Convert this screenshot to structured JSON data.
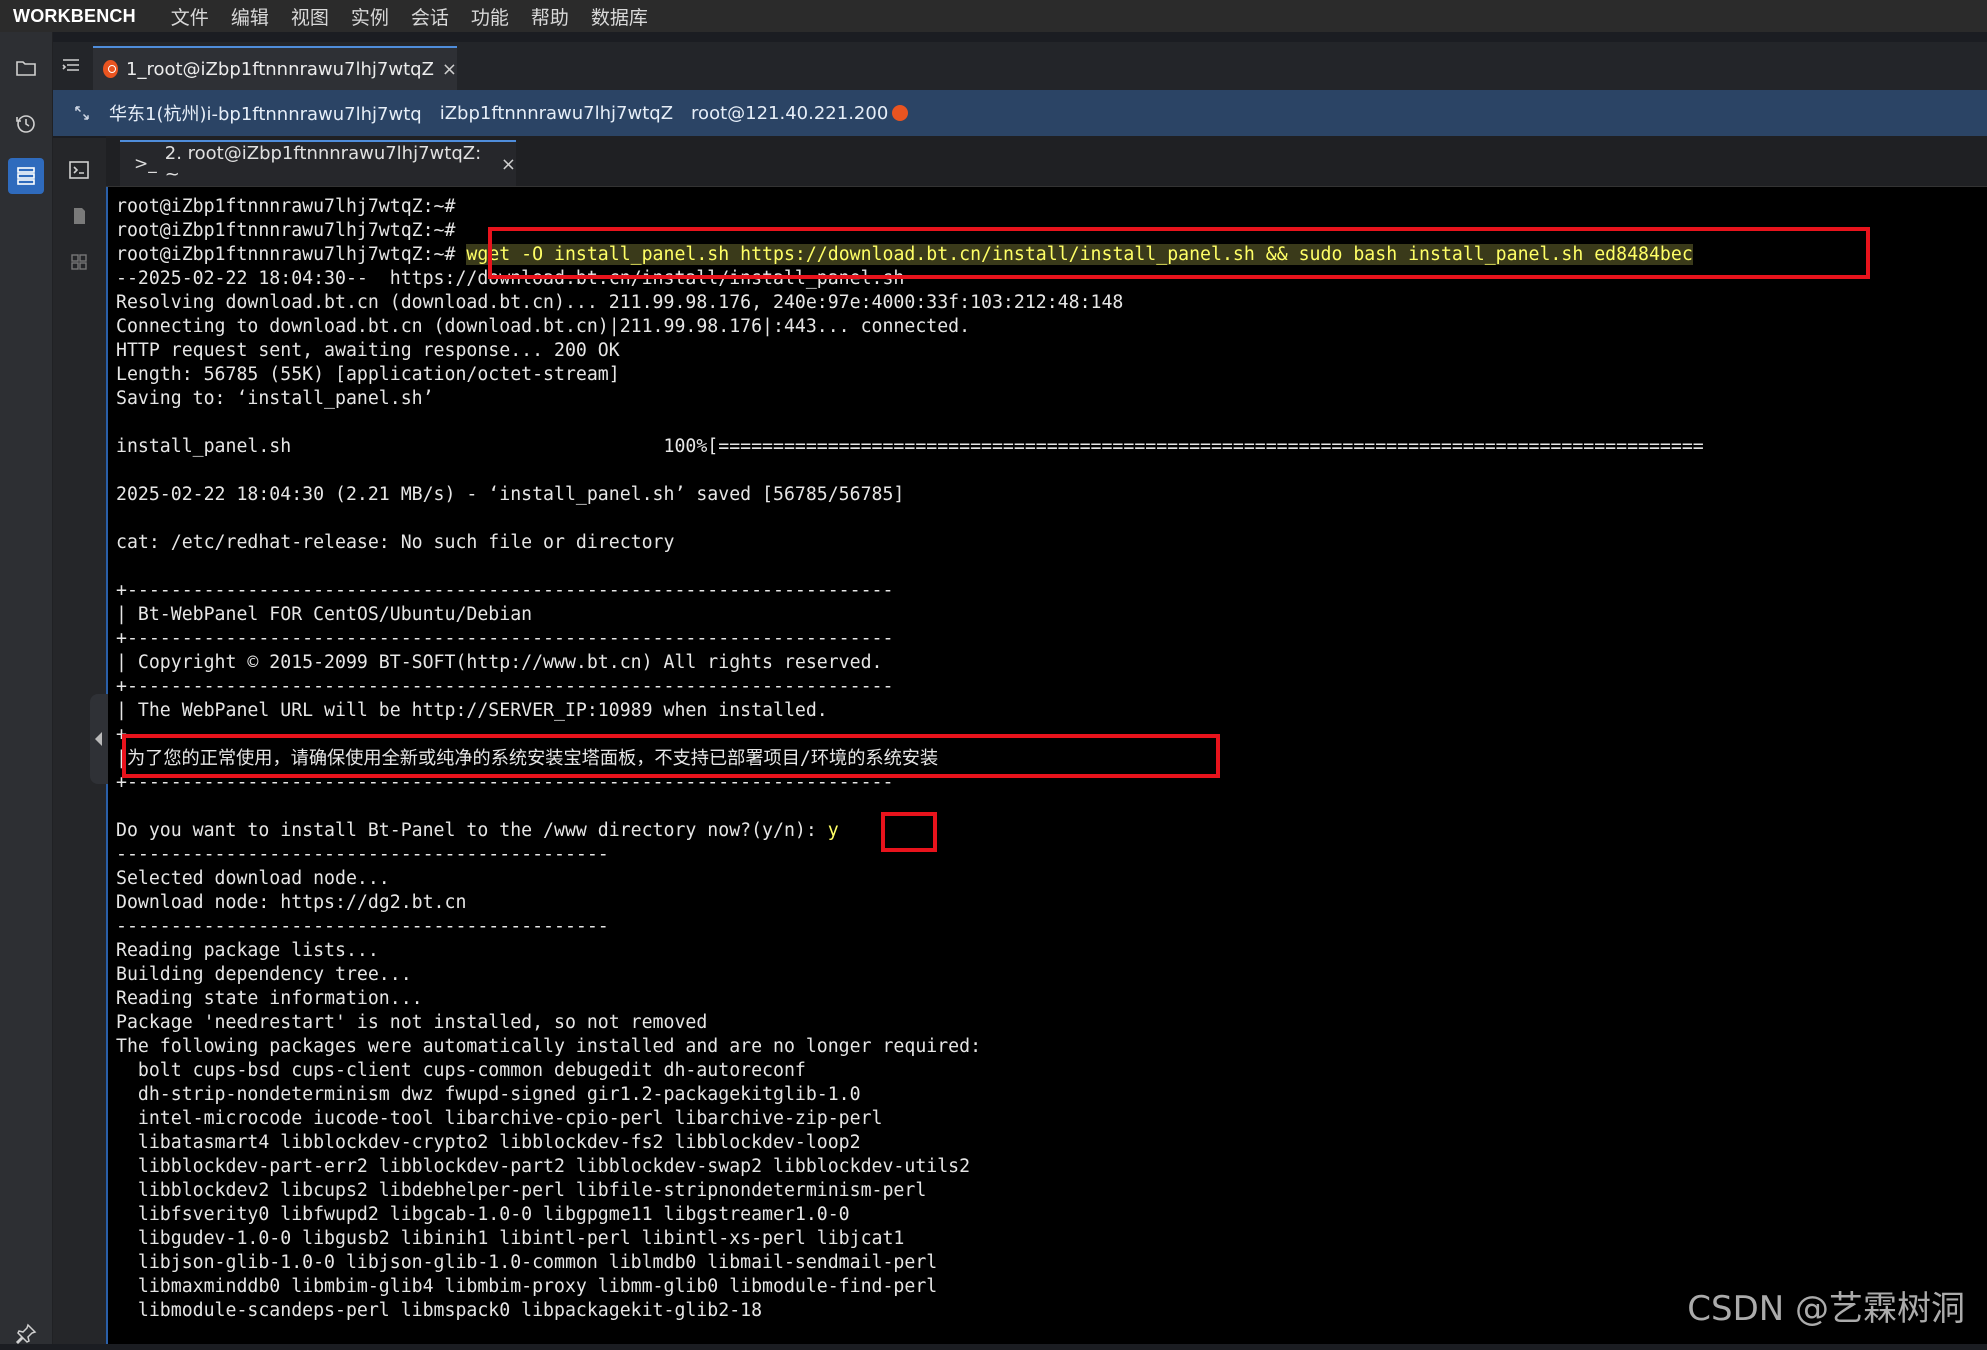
{
  "menubar": {
    "brand": "WORKBENCH",
    "items": [
      "文件",
      "编辑",
      "视图",
      "实例",
      "会话",
      "功能",
      "帮助",
      "数据库"
    ]
  },
  "session_tab": {
    "title": "1_root@iZbp1ftnnnrawu7lhj7wtqZ",
    "close": "×"
  },
  "infobar": {
    "region": "华东1(杭州)i-bp1ftnnnrawu7lhj7wtq",
    "hostname": "iZbp1ftnnnrawu7lhj7wtqZ",
    "login": "root@121.40.221.200"
  },
  "terminal_tab": {
    "prompt_glyph": ">_",
    "title": "2. root@iZbp1ftnnnrawu7lhj7wtqZ: ~",
    "close": "×"
  },
  "terminal": {
    "prompt": "root@iZbp1ftnnnrawu7lhj7wtqZ:~#",
    "command": "wget -O install_panel.sh https://download.bt.cn/install/install_panel.sh && sudo bash install_panel.sh ed8484bec",
    "lines": [
      "root@iZbp1ftnnnrawu7lhj7wtqZ:~#",
      "root@iZbp1ftnnnrawu7lhj7wtqZ:~#",
      "__CMD__",
      "--2025-02-22 18:04:30--  https://download.bt.cn/install/install_panel.sh",
      "Resolving download.bt.cn (download.bt.cn)... 211.99.98.176, 240e:97e:4000:33f:103:212:48:148",
      "Connecting to download.bt.cn (download.bt.cn)|211.99.98.176|:443... connected.",
      "HTTP request sent, awaiting response... 200 OK",
      "Length: 56785 (55K) [application/octet-stream]",
      "Saving to: ‘install_panel.sh’",
      "",
      "install_panel.sh                                  100%[==========================================================================================",
      "",
      "2025-02-22 18:04:30 (2.21 MB/s) - ‘install_panel.sh’ saved [56785/56785]",
      "",
      "cat: /etc/redhat-release: No such file or directory",
      "",
      "+----------------------------------------------------------------------",
      "| Bt-WebPanel FOR CentOS/Ubuntu/Debian",
      "+----------------------------------------------------------------------",
      "| Copyright © 2015-2099 BT-SOFT(http://www.bt.cn) All rights reserved.",
      "+----------------------------------------------------------------------",
      "| The WebPanel URL will be http://SERVER_IP:10989 when installed.",
      "+----------------------------------------------------------------------",
      "|为了您的正常使用，请确保使用全新或纯净的系统安装宝塔面板，不支持已部署项目/环境的系统安装",
      "+----------------------------------------------------------------------",
      "",
      "__Y__",
      "---------------------------------------------",
      "Selected download node...",
      "Download node: https://dg2.bt.cn",
      "---------------------------------------------",
      "Reading package lists...",
      "Building dependency tree...",
      "Reading state information...",
      "Package 'needrestart' is not installed, so not removed",
      "The following packages were automatically installed and are no longer required:",
      "  bolt cups-bsd cups-client cups-common debugedit dh-autoreconf",
      "  dh-strip-nondeterminism dwz fwupd-signed gir1.2-packagekitglib-1.0",
      "  intel-microcode iucode-tool libarchive-cpio-perl libarchive-zip-perl",
      "  libatasmart4 libblockdev-crypto2 libblockdev-fs2 libblockdev-loop2",
      "  libblockdev-part-err2 libblockdev-part2 libblockdev-swap2 libblockdev-utils2",
      "  libblockdev2 libcups2 libdebhelper-perl libfile-stripnondeterminism-perl",
      "  libfsverity0 libfwupd2 libgcab-1.0-0 libgpgme11 libgstreamer1.0-0",
      "  libgudev-1.0-0 libgusb2 libinih1 libintl-perl libintl-xs-perl libjcat1",
      "  libjson-glib-1.0-0 libjson-glib-1.0-common liblmdb0 libmail-sendmail-perl",
      "  libmaxminddb0 libmbim-glib4 libmbim-proxy libmm-glib0 libmodule-find-perl",
      "  libmodule-scandeps-perl libmspack0 libpackagekit-glib2-18"
    ],
    "question": "Do you want to install Bt-Panel to the /www directory now?(y/n): ",
    "answer": "y"
  },
  "watermark": "CSDN @艺霖树洞",
  "colors": {
    "highlight_red": "#e8131c",
    "command_yellow": "#ffff66",
    "tab_accent": "#4f8ddb",
    "infobar_bg": "#2b4465"
  }
}
